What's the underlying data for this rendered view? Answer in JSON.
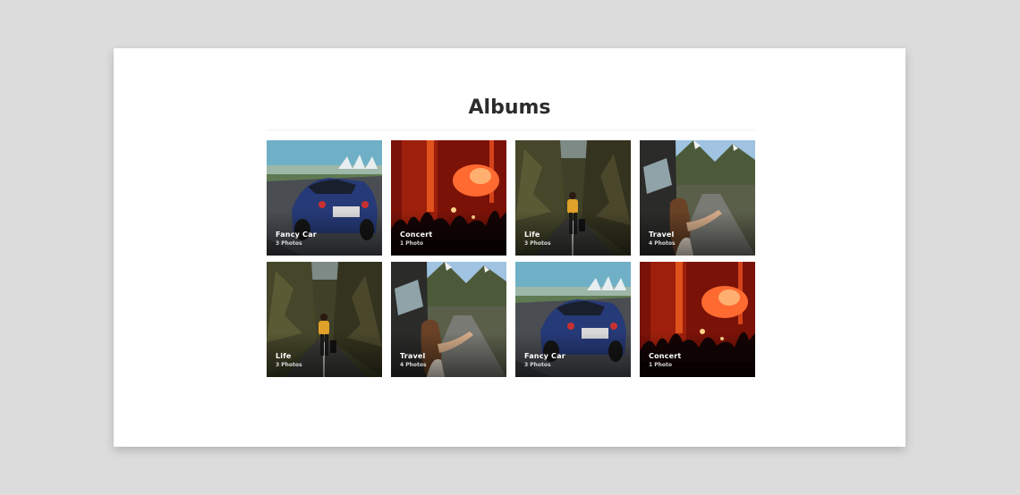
{
  "page": {
    "title": "Albums"
  },
  "albums": [
    {
      "name": "Fancy Car",
      "count": "3 Photos",
      "scene": "car"
    },
    {
      "name": "Concert",
      "count": "1 Photo",
      "scene": "concert"
    },
    {
      "name": "Life",
      "count": "3 Photos",
      "scene": "life"
    },
    {
      "name": "Travel",
      "count": "4 Photos",
      "scene": "travel"
    },
    {
      "name": "Life",
      "count": "3 Photos",
      "scene": "life"
    },
    {
      "name": "Travel",
      "count": "4 Photos",
      "scene": "travel"
    },
    {
      "name": "Fancy Car",
      "count": "3 Photos",
      "scene": "car"
    },
    {
      "name": "Concert",
      "count": "1 Photo",
      "scene": "concert"
    }
  ]
}
